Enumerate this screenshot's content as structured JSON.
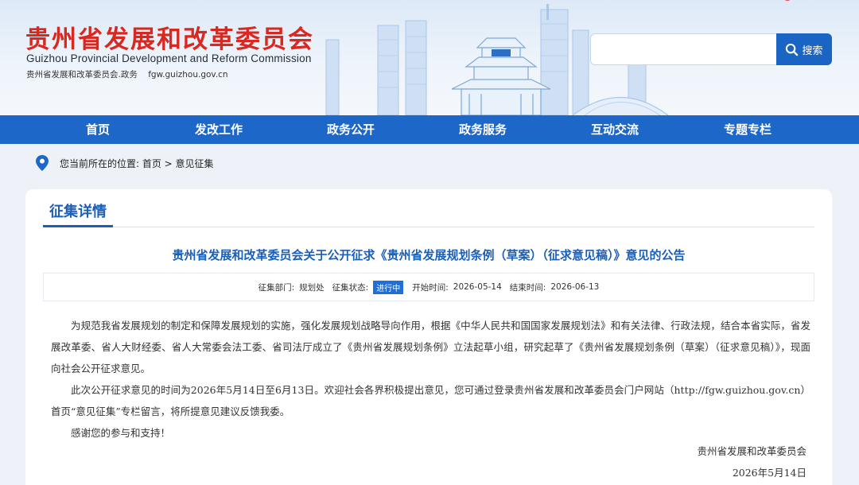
{
  "header": {
    "title_cn": "贵州省发展和改革委员会",
    "title_en": "Guizhou Provincial Development and Reform Commission",
    "sub_site": "贵州省发展和改革委员会.政务",
    "sub_domain": "fgw.guizhou.gov.cn",
    "search_placeholder": "",
    "search_label": "搜索",
    "brand_color": "#d8281f",
    "accent_color": "#1d67c9"
  },
  "nav": {
    "items": [
      {
        "label": "首页"
      },
      {
        "label": "发改工作"
      },
      {
        "label": "政务公开"
      },
      {
        "label": "政务服务"
      },
      {
        "label": "互动交流"
      },
      {
        "label": "专题专栏"
      }
    ]
  },
  "breadcrumb": {
    "text": "您当前所在的位置: 首页 > 意见征集"
  },
  "card": {
    "tab": "征集详情",
    "title": "贵州省发展和改革委员会关于公开征求《贵州省发展规划条例（草案）（征求意见稿）》意见的公告",
    "meta": {
      "dept_label": "征集部门:",
      "dept": "规划处",
      "status_label": "征集状态:",
      "status": "进行中",
      "start_label": "开始时间:",
      "start": "2026-05-14",
      "end_label": "结束时间:",
      "end": "2026-06-13"
    },
    "paragraphs": [
      "为规范我省发展规划的制定和保障发展规划的实施，强化发展规划战略导向作用，根据《中华人民共和国国家发展规划法》和有关法律、行政法规，结合本省实际，省发展改革委、省人大财经委、省人大常委会法工委、省司法厅成立了《贵州省发展规划条例》立法起草小组，研究起草了《贵州省发展规划条例（草案）（征求意见稿）》，现面向社会公开征求意见。",
      "此次公开征求意见的时间为2026年5月14日至6月13日。欢迎社会各界积极提出意见，您可通过登录贵州省发展和改革委员会门户网站（http://fgw.guizhou.gov.cn）首页“意见征集”专栏留言，将所提意见建议反馈我委。",
      "感谢您的参与和支持！"
    ],
    "signature": "贵州省发展和改革委员会",
    "date": "2026年5月14日"
  }
}
